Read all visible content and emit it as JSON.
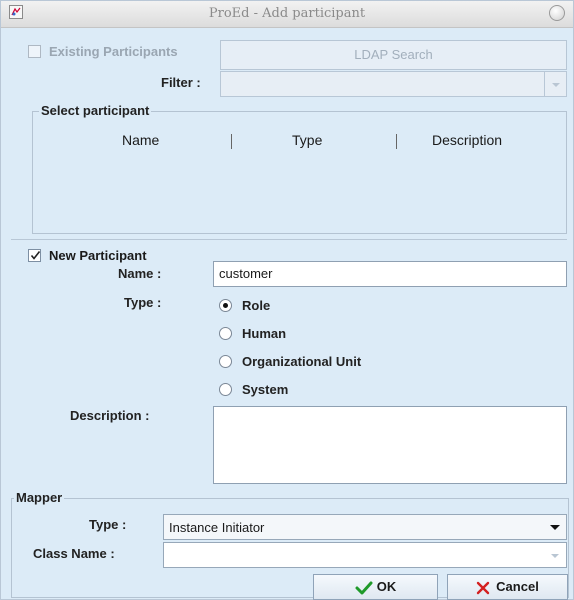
{
  "window": {
    "title": "ProEd - Add participant"
  },
  "existing": {
    "checkbox_label": "Existing Participants",
    "checked": false,
    "ldap_button": "LDAP Search",
    "filter_label": "Filter :",
    "filter_value": ""
  },
  "select_group": {
    "title": "Select participant",
    "columns": [
      "Name",
      "Type",
      "Description"
    ]
  },
  "new_participant": {
    "checkbox_label": "New Participant",
    "checked": true,
    "name_label": "Name :",
    "name_value": "customer",
    "type_label": "Type :",
    "types": [
      {
        "label": "Role",
        "selected": true
      },
      {
        "label": "Human",
        "selected": false
      },
      {
        "label": "Organizational Unit",
        "selected": false
      },
      {
        "label": "System",
        "selected": false
      }
    ],
    "description_label": "Description :",
    "description_value": ""
  },
  "mapper": {
    "title": "Mapper",
    "type_label": "Type :",
    "type_value": "Instance Initiator",
    "class_label": "Class Name :",
    "class_value": ""
  },
  "actions": {
    "ok_label": "OK",
    "cancel_label": "Cancel"
  },
  "colors": {
    "background": "#dcebf7",
    "ok_check": "#1f9a2a",
    "cancel_x": "#d32020"
  }
}
